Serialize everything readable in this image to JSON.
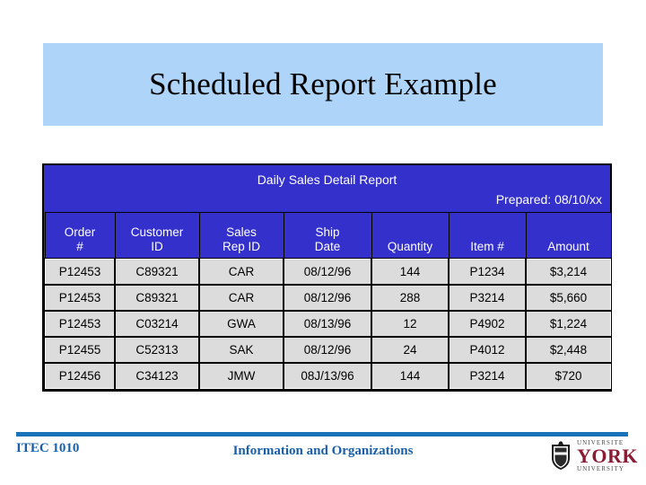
{
  "slide": {
    "title": "Scheduled Report Example",
    "banner_color": "#aed4f9"
  },
  "report": {
    "title": "Daily Sales Detail Report",
    "prepared": "Prepared: 08/10/xx",
    "header_color": "#3330cc",
    "cell_color": "#dcdcdc",
    "columns": [
      {
        "line1": "Order",
        "line2": "#"
      },
      {
        "line1": "Customer",
        "line2": "ID"
      },
      {
        "line1": "Sales",
        "line2": "Rep ID"
      },
      {
        "line1": "Ship",
        "line2": "Date"
      },
      {
        "line1": "",
        "line2": "Quantity"
      },
      {
        "line1": "",
        "line2": "Item #"
      },
      {
        "line1": "",
        "line2": "Amount"
      }
    ],
    "rows": [
      {
        "order": "P12453",
        "customer": "C89321",
        "rep": "CAR",
        "ship": "08/12/96",
        "quantity": "144",
        "item": "P1234",
        "amount": "$3,214"
      },
      {
        "order": "P12453",
        "customer": "C89321",
        "rep": "CAR",
        "ship": "08/12/96",
        "quantity": "288",
        "item": "P3214",
        "amount": "$5,660"
      },
      {
        "order": "P12453",
        "customer": "C03214",
        "rep": "GWA",
        "ship": "08/13/96",
        "quantity": "12",
        "item": "P4902",
        "amount": "$1,224"
      },
      {
        "order": "P12455",
        "customer": "C52313",
        "rep": "SAK",
        "ship": "08/12/96",
        "quantity": "24",
        "item": "P4012",
        "amount": "$2,448"
      },
      {
        "order": "P12456",
        "customer": "C34123",
        "rep": "JMW",
        "ship": "08J/13/96",
        "quantity": "144",
        "item": "P3214",
        "amount": "$720"
      }
    ]
  },
  "footer": {
    "course": "ITEC 1010",
    "subject": "Information and Organizations",
    "rule_color": "#1a72b8",
    "text_color": "#1a5fa8",
    "logo": {
      "top_word": "UNIVERSITE",
      "main_word": "YORK",
      "bottom_word": "UNIVERSITY",
      "main_color": "#8c1b33"
    }
  }
}
